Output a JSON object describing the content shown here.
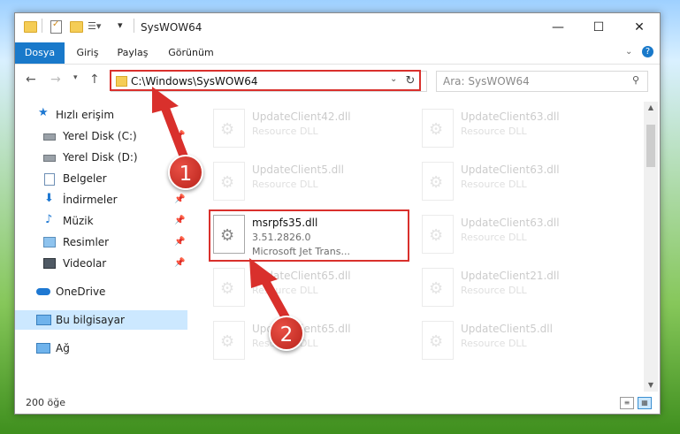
{
  "window": {
    "title": "SysWOW64",
    "controls": {
      "minimize": "—",
      "maximize": "☐",
      "close": "✕"
    }
  },
  "ribbon": {
    "tabs": [
      "Dosya",
      "Giriş",
      "Paylaş",
      "Görünüm"
    ],
    "help": "?"
  },
  "navigation": {
    "address": "C:\\Windows\\SysWOW64",
    "search_placeholder": "Ara: SysWOW64"
  },
  "sidebar": {
    "quick_access": "Hızlı erişim",
    "items": [
      {
        "label": "Yerel Disk (C:)",
        "icon": "drive-icon",
        "pinned": true
      },
      {
        "label": "Yerel Disk (D:)",
        "icon": "drive-icon",
        "pinned": false
      },
      {
        "label": "Belgeler",
        "icon": "documents-icon",
        "pinned": true
      },
      {
        "label": "İndirmeler",
        "icon": "downloads-icon",
        "pinned": true
      },
      {
        "label": "Müzik",
        "icon": "music-icon",
        "pinned": true
      },
      {
        "label": "Resimler",
        "icon": "pictures-icon",
        "pinned": true
      },
      {
        "label": "Videolar",
        "icon": "videos-icon",
        "pinned": true
      }
    ],
    "onedrive": "OneDrive",
    "this_pc": "Bu bilgisayar",
    "network": "Ağ"
  },
  "files": [
    {
      "name": "UpdateClient42.dll",
      "type": "Resource DLL",
      "faded": true
    },
    {
      "name": "UpdateClient63.dll",
      "type": "Resource DLL",
      "faded": true
    },
    {
      "name": "UpdateClient5.dll",
      "type": "Resource DLL",
      "faded": true
    },
    {
      "name": "UpdateClient63.dll",
      "type": "Resource DLL",
      "faded": true
    },
    {
      "name": "msrpfs35.dll",
      "version": "3.51.2826.0",
      "description": "Microsoft Jet Trans...",
      "faded": false
    },
    {
      "name": "UpdateClient63.dll",
      "type": "Resource DLL",
      "faded": true
    },
    {
      "name": "UpdateClient65.dll",
      "type": "Resource DLL",
      "faded": true
    },
    {
      "name": "UpdateClient21.dll",
      "type": "Resource DLL",
      "faded": true
    },
    {
      "name": "UpdateClient65.dll",
      "type": "Resource DLL",
      "faded": true
    },
    {
      "name": "UpdateClient5.dll",
      "type": "Resource DLL",
      "faded": true
    }
  ],
  "status": {
    "item_count": "200 öğe"
  },
  "callouts": [
    "1",
    "2"
  ],
  "colors": {
    "accent": "#1979ca",
    "highlight": "#d9302c",
    "selected_nav": "#cce8ff"
  }
}
